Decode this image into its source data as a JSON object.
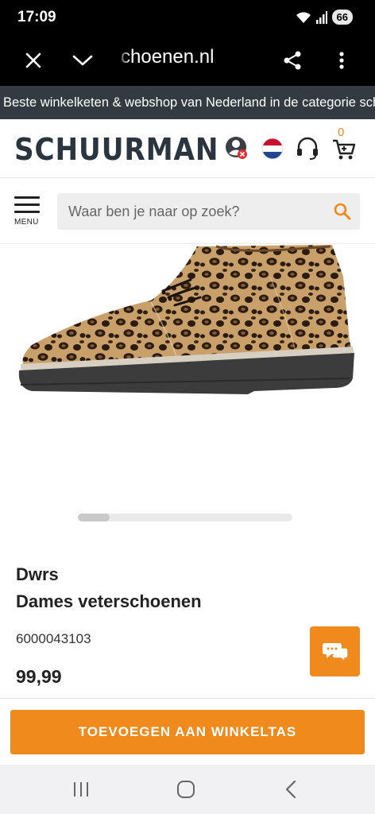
{
  "status_bar": {
    "time": "17:09",
    "battery": "66",
    "icons": [
      "wifi-icon",
      "signal-icon",
      "battery-icon"
    ]
  },
  "browser": {
    "url": "choenen.nl",
    "buttons": [
      "close-icon",
      "chevron-down-icon",
      "share-icon",
      "more-vert-icon"
    ]
  },
  "ticker": {
    "text": "Beste winkelketen & webshop van Nederland in de categorie schoenen"
  },
  "header": {
    "logo": "SCHUURMAN",
    "cart_count": "0",
    "icons": [
      "account-icon",
      "flag-nl-icon",
      "headset-icon",
      "cart-icon"
    ]
  },
  "search": {
    "menu_label": "MENU",
    "placeholder": "Waar ben je naar op zoek?"
  },
  "product": {
    "brand": "Dwrs",
    "name": "Dames veterschoenen",
    "sku": "6000043103",
    "price": "99,99",
    "image": "leopard-print-ankle-boot",
    "gallery_scroll_fraction": 0.15
  },
  "actions": {
    "add_to_cart": "TOEVOEGEN AAN WINKELTAS",
    "chat_icon": "chat-icon"
  },
  "colors": {
    "accent": "#f08a1c",
    "ticker_bg": "#333a41",
    "logo": "#2b3540"
  },
  "android_nav": [
    "recents-icon",
    "home-icon",
    "back-icon"
  ]
}
